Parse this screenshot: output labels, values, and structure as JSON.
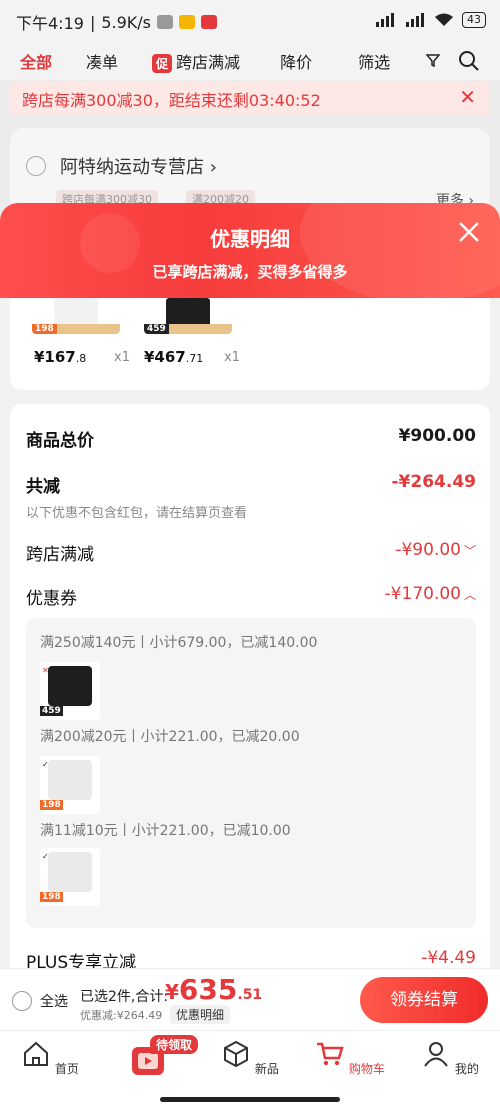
{
  "status_bar": {
    "time": "下午4:19",
    "speed": "5.9K/s",
    "battery": "43"
  },
  "background_page": {
    "tabs": [
      "全部",
      "凑单",
      "跨店满减",
      "降价",
      "筛选"
    ],
    "promo_tag": "促",
    "notice": "跨店每满300减30，距结束还剩03:40:52",
    "shop_name": "阿特纳运动专营店",
    "chips": [
      "跨店每满300减30",
      "满200减20"
    ],
    "more": "更多"
  },
  "popup": {
    "title": "优惠明细",
    "subtitle": "已享跨店满减，买得多省得多",
    "items": [
      {
        "tag": "198",
        "price_main": "¥167",
        "price_cents": ".8",
        "qty": "x1"
      },
      {
        "tag": "459",
        "price_main": "¥467",
        "price_cents": ".71",
        "qty": "x1"
      }
    ],
    "summary": {
      "total_label": "商品总价",
      "total_value": "¥900.00",
      "discount_label": "共减",
      "discount_value": "-¥264.49",
      "discount_hint": "以下优惠不包含红包，请在结算页查看",
      "cross_store_label": "跨店满减",
      "cross_store_value": "-¥90.00",
      "coupon_label": "优惠券",
      "coupon_value": "-¥170.00",
      "coupons": [
        {
          "text": "满250减140元丨小计679.00，已减140.00",
          "tag": "459"
        },
        {
          "text": "满200减20元丨小计221.00，已减20.00",
          "tag": "198"
        },
        {
          "text": "满11减10元丨小计221.00，已减10.00",
          "tag": "198"
        }
      ],
      "plus_label": "PLUS专享立减",
      "plus_value": "-¥4.49"
    }
  },
  "checkout": {
    "select_all": "全选",
    "selected": "已选2件,合计:",
    "currency": "¥",
    "amount_int": "635",
    "amount_dec": ".51",
    "discount": "优惠减:¥264.49",
    "detail_button": "优惠明细",
    "pay_button": "领券结算"
  },
  "tabbar": {
    "items": [
      "首页",
      "新品",
      "购物车",
      "我的"
    ],
    "claim_badge": "待领取"
  },
  "colors": {
    "accent": "#e4393c"
  }
}
